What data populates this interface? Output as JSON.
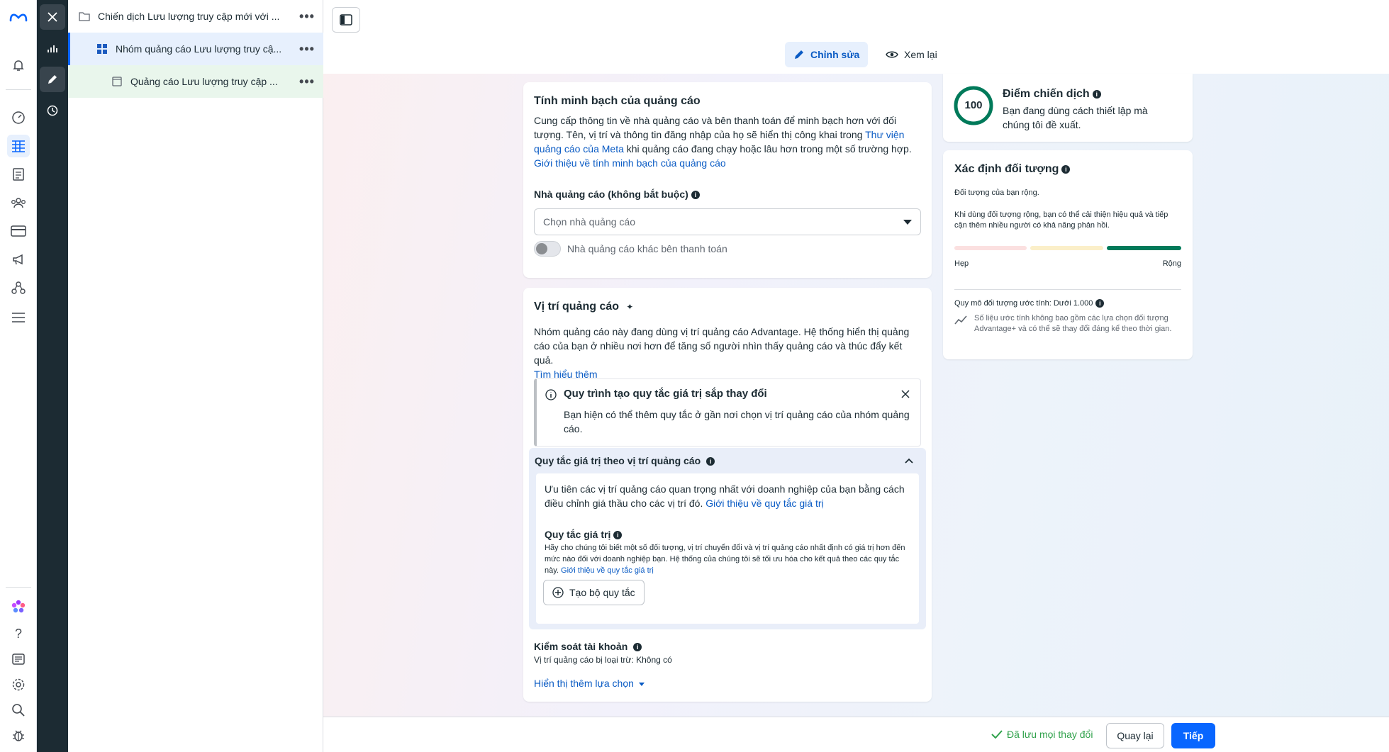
{
  "colors": {
    "accent": "#0866ff",
    "rail_dark": "#1c2b33",
    "success": "#31a24c",
    "audience_bar": "#007a5a"
  },
  "tree": {
    "items": [
      {
        "label": "Chiến dịch Lưu lượng truy cập mới với ...",
        "icon": "folder-icon"
      },
      {
        "label": "Nhóm quảng cáo Lưu lượng truy cậ...",
        "icon": "ad-set-grid-icon"
      },
      {
        "label": "Quảng cáo Lưu lượng truy cập ...",
        "icon": "ad-icon"
      }
    ]
  },
  "header": {
    "edit_label": "Chỉnh sửa",
    "review_label": "Xem lại"
  },
  "transparency": {
    "title": "Tính minh bạch của quảng cáo",
    "desc_part1": "Cung cấp thông tin về nhà quảng cáo và bên thanh toán để minh bạch hơn với đối tượng. Tên, vị trí và thông tin đăng nhập của họ sẽ hiển thị công khai trong ",
    "desc_link": "Thư viện quảng cáo của Meta",
    "desc_part2": " khi quảng cáo đang chạy hoặc lâu hơn trong một số trường hợp.",
    "learn_link": "Giới thiệu về tính minh bạch của quảng cáo",
    "advertiser_label": "Nhà quảng cáo (không bắt buộc)",
    "advertiser_placeholder": "Chọn nhà quảng cáo",
    "payer_toggle_label": "Nhà quảng cáo khác bên thanh toán"
  },
  "placements": {
    "title": "Vị trí quảng cáo",
    "desc": "Nhóm quảng cáo này đang dùng vị trí quảng cáo Advantage. Hệ thống hiển thị quảng cáo của bạn ở nhiều nơi hơn để tăng số người nhìn thấy quảng cáo và thúc đẩy kết quả.",
    "learn_more": "Tìm hiểu thêm",
    "notice_title": "Quy trình tạo quy tắc giá trị sắp thay đổi",
    "notice_body": "Bạn hiện có thể thêm quy tắc ở gần nơi chọn vị trí quảng cáo của nhóm quảng cáo.",
    "rules_header": "Quy tắc giá trị theo vị trí quảng cáo",
    "rules_desc": "Ưu tiên các vị trí quảng cáo quan trọng nhất với doanh nghiệp của bạn bằng cách điều chỉnh giá thầu cho các vị trí đó.",
    "rules_link": "Giới thiệu về quy tắc giá trị",
    "value_rules_title": "Quy tắc giá trị",
    "value_rules_desc": "Hãy cho chúng tôi biết một số đối tượng, vị trí chuyển đổi và vị trí quảng cáo nhất định có giá trị hơn đến mức nào đối với doanh nghiệp bạn. Hệ thống của chúng tôi sẽ tối ưu hóa cho kết quả theo các quy tắc này.",
    "value_rules_link": "Giới thiệu về quy tắc giá trị",
    "create_rule_button": "Tạo bộ quy tắc",
    "account_controls_title": "Kiểm soát tài khoản",
    "account_controls_value": "Vị trí quảng cáo bị loại trừ: Không có",
    "show_more": "Hiển thị thêm lựa chọn"
  },
  "score": {
    "value": "100",
    "title": "Điểm chiến dịch",
    "desc": "Bạn đang dùng cách thiết lập mà chúng tôi đề xuất."
  },
  "audience": {
    "title": "Xác định đối tượng",
    "status": "Đối tượng của bạn rộng.",
    "advice": "Khi dùng đối tượng rộng, bạn có thể cải thiện hiệu quả và tiếp cận thêm nhiều người có khả năng phản hồi.",
    "narrow_label": "Hẹp",
    "broad_label": "Rộng",
    "size_label": "Quy mô đối tượng ước tính: Dưới 1.000",
    "size_note": "Số liệu ước tính không bao gồm các lựa chọn đối tượng Advantage+ và có thể sẽ thay đổi đáng kể theo thời gian.",
    "meter_level": "broad"
  },
  "footer": {
    "saved": "Đã lưu mọi thay đổi",
    "back": "Quay lại",
    "next": "Tiếp"
  }
}
